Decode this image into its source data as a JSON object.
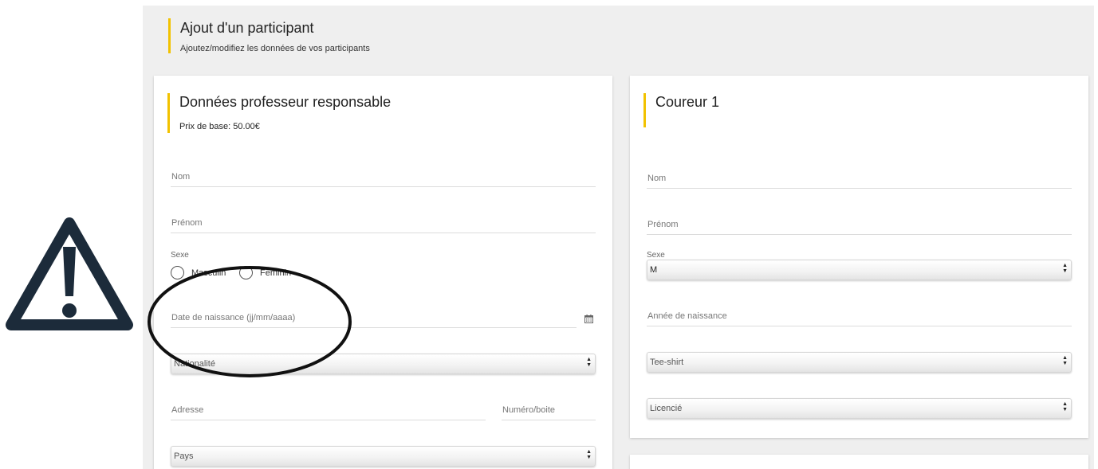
{
  "header": {
    "title": "Ajout d'un participant",
    "subtitle": "Ajoutez/modifiez les données de vos participants"
  },
  "teacher_card": {
    "title": "Données professeur responsable",
    "base_price": "Prix de base: 50.00€",
    "fields": {
      "nom": "Nom",
      "prenom": "Prénom",
      "sexe_label": "Sexe",
      "sexe_options": [
        "Masculin",
        "Feminin"
      ],
      "birthdate": "Date de naissance (jj/mm/aaaa)",
      "nationalite": "Nationalité",
      "adresse": "Adresse",
      "numero": "Numéro/boite",
      "pays": "Pays"
    }
  },
  "runner_card": {
    "title": "Coureur 1",
    "fields": {
      "nom": "Nom",
      "prenom": "Prénom",
      "sexe_label": "Sexe",
      "sexe_value": "M",
      "annee": "Année de naissance",
      "tshirt": "Tee-shirt",
      "licencie": "Licencié"
    }
  },
  "icons": {
    "warning": "warning-triangle-icon",
    "calendar": "calendar-icon",
    "select_arrows": "up-down-arrows-icon"
  },
  "colors": {
    "accent": "#f2c200",
    "page_background": "#efefef",
    "card_background": "#ffffff"
  }
}
